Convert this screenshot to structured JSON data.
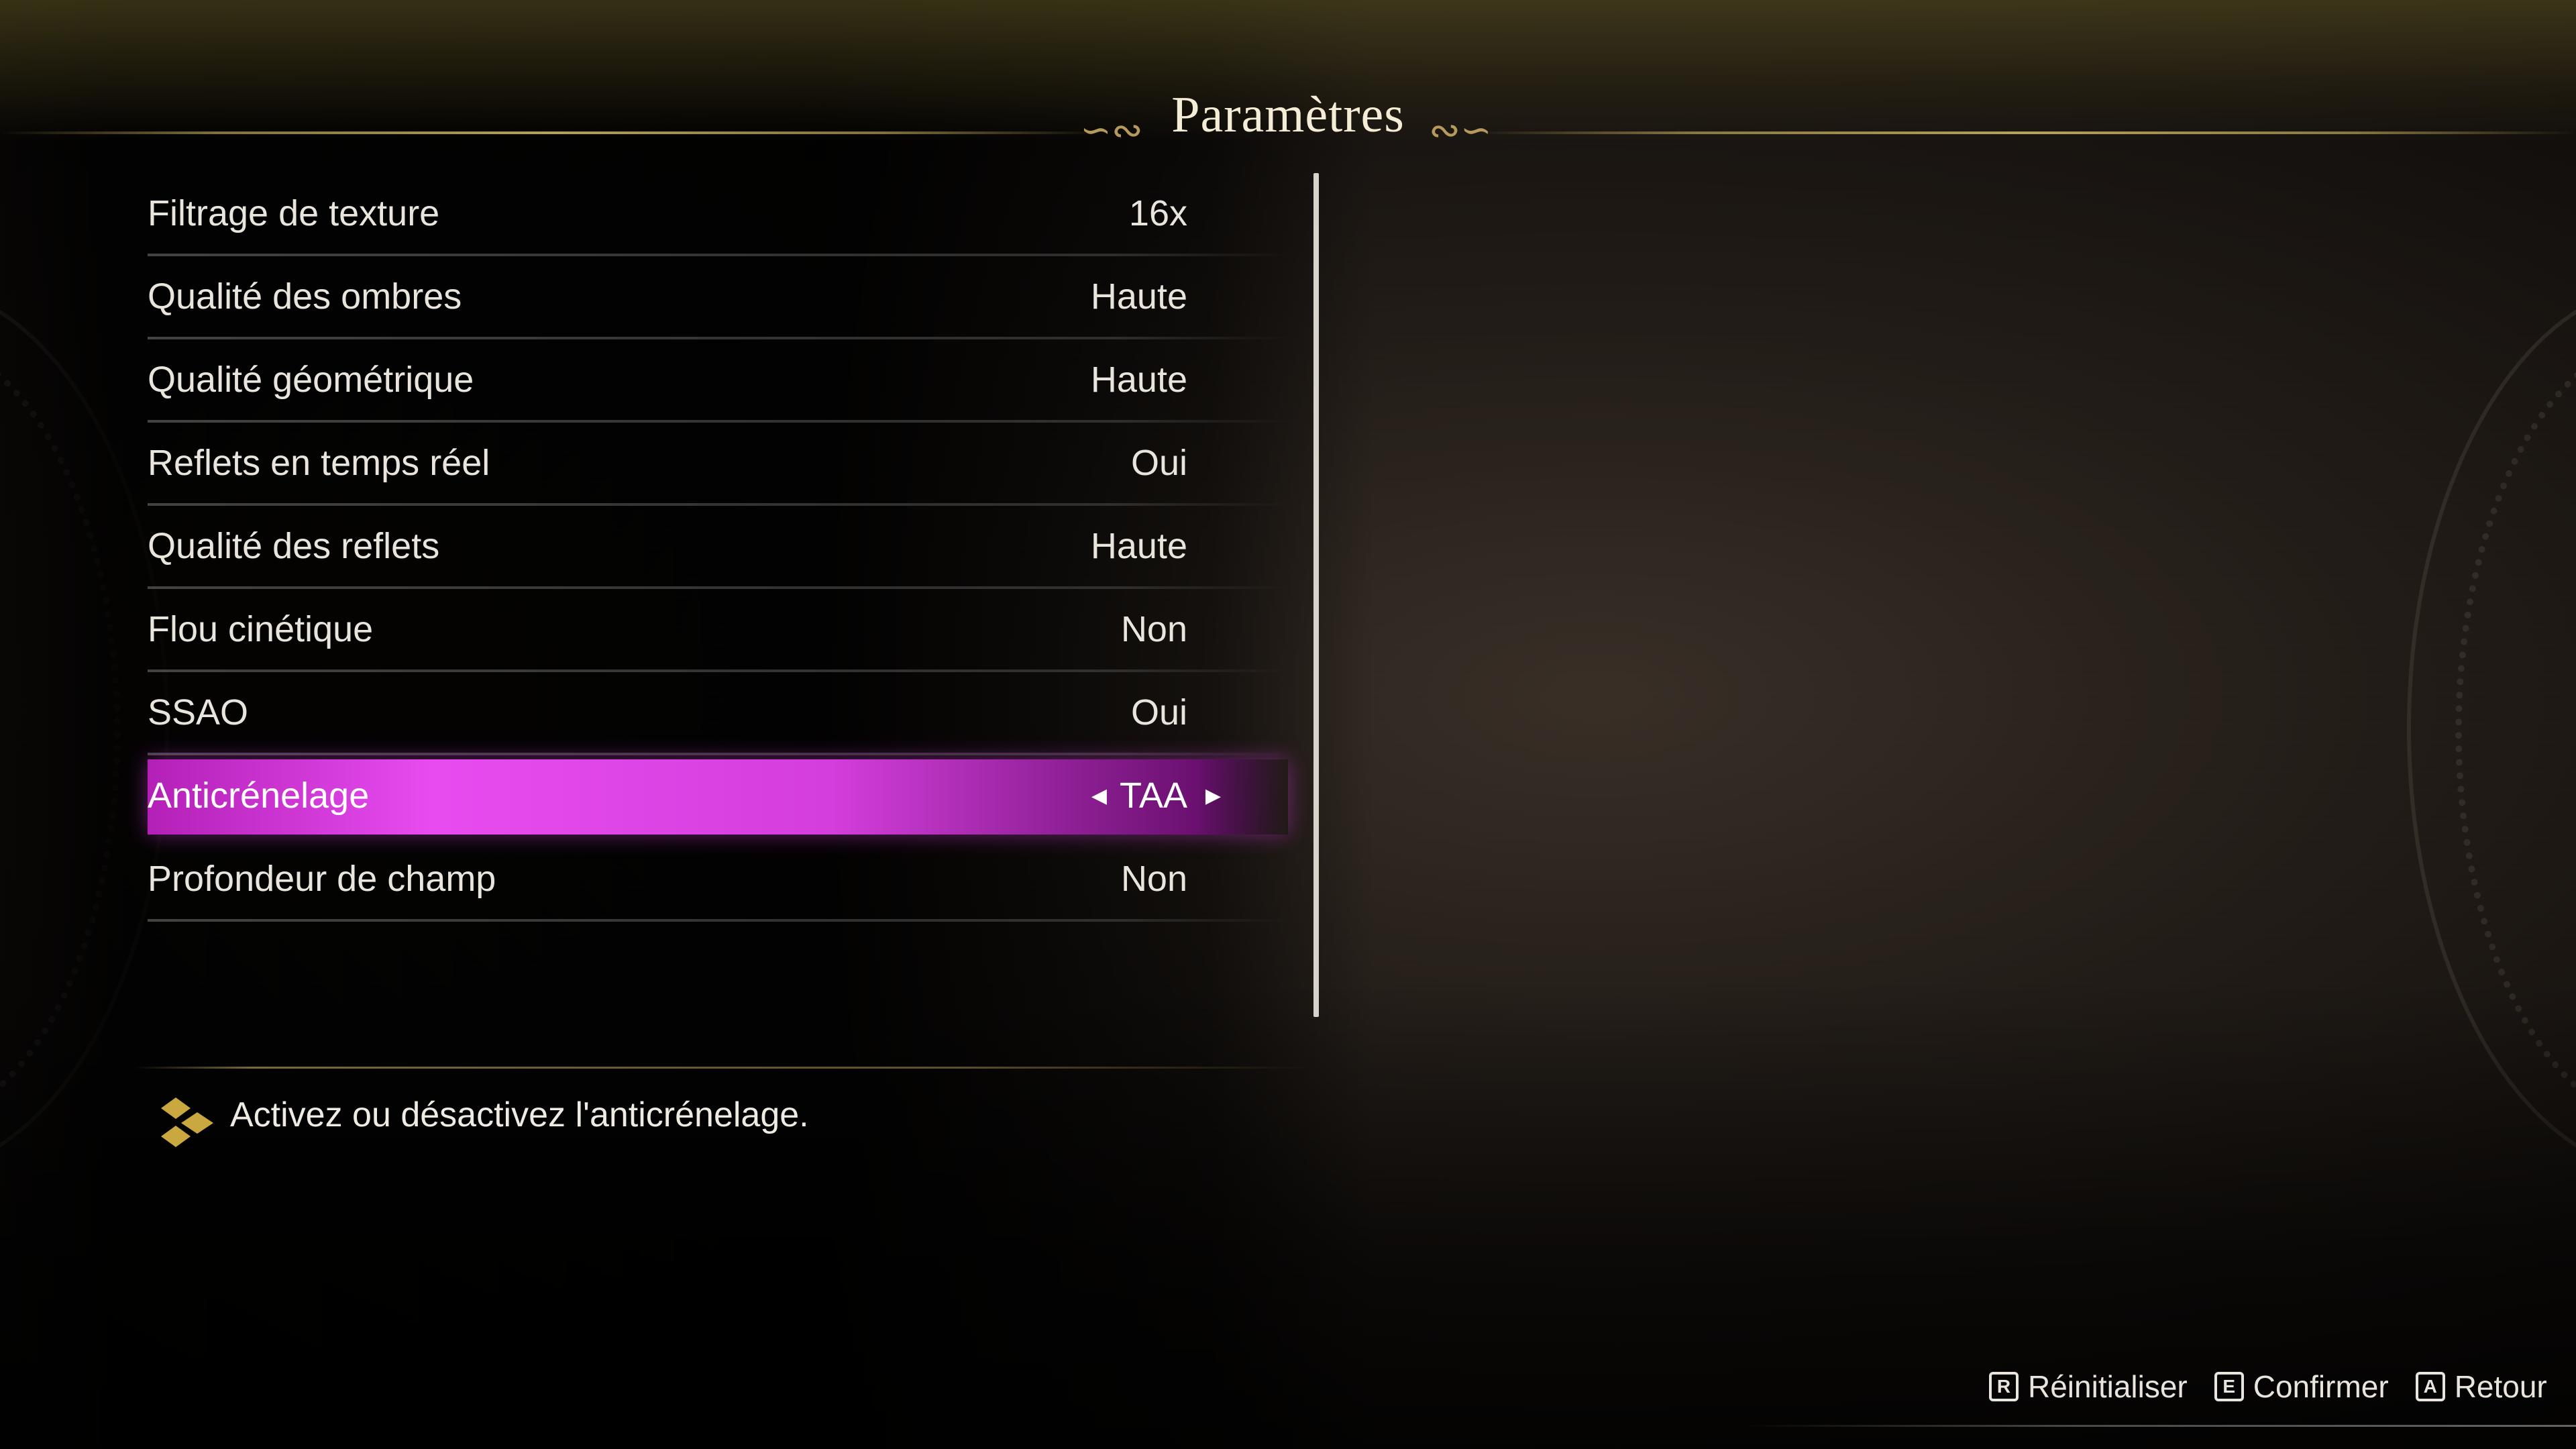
{
  "header": {
    "title": "Paramètres",
    "flourish_left": "∽∾",
    "flourish_right": "∾∽"
  },
  "settings": {
    "items": [
      {
        "label": "Filtrage de texture",
        "value": "16x"
      },
      {
        "label": "Qualité des ombres",
        "value": "Haute"
      },
      {
        "label": "Qualité géométrique",
        "value": "Haute"
      },
      {
        "label": "Reflets en temps réel",
        "value": "Oui"
      },
      {
        "label": "Qualité des reflets",
        "value": "Haute"
      },
      {
        "label": "Flou cinétique",
        "value": "Non"
      },
      {
        "label": "SSAO",
        "value": "Oui"
      },
      {
        "label": "Anticrénelage",
        "value": "TAA",
        "selected": true
      },
      {
        "label": "Profondeur de champ",
        "value": "Non"
      }
    ],
    "arrow_left": "◀",
    "arrow_right": "▶"
  },
  "hint": {
    "text": "Activez ou désactivez l'anticrénelage.",
    "icon": "diamond-cluster-icon"
  },
  "footer": {
    "buttons": [
      {
        "key": "R",
        "label": "Réinitialiser"
      },
      {
        "key": "E",
        "label": "Confirmer"
      },
      {
        "key": "A",
        "label": "Retour"
      }
    ]
  },
  "colors": {
    "highlight": "#e84cf0",
    "gold_accent": "#c9a93f",
    "text": "#e9e4dc"
  }
}
